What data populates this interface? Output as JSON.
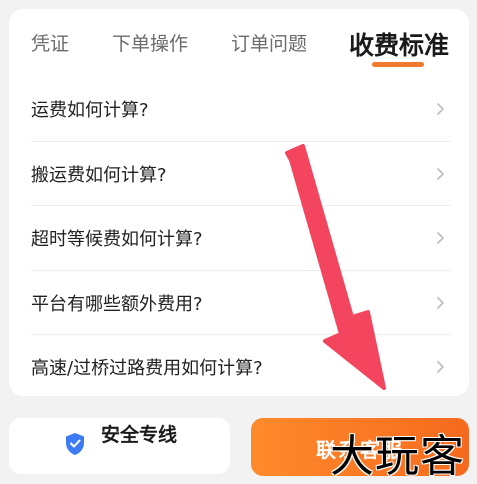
{
  "tabs": [
    {
      "label": "凭证",
      "active": false
    },
    {
      "label": "下单操作",
      "active": false
    },
    {
      "label": "订单问题",
      "active": false
    },
    {
      "label": "收费标准",
      "active": true
    }
  ],
  "faq_items": [
    {
      "label": "运费如何计算?"
    },
    {
      "label": "搬运费如何计算?"
    },
    {
      "label": "超时等候费如何计算?"
    },
    {
      "label": "平台有哪些额外费用?"
    },
    {
      "label": "高速/过桥过路费用如何计算?"
    }
  ],
  "bottom": {
    "safety_label": "安全专线",
    "contact_label": "联系客服"
  },
  "watermark": {
    "text": "大玩客"
  },
  "colors": {
    "accent": "#f07a2d",
    "arrow": "#f4455f",
    "shield": "#3d7bf5",
    "card_bg": "#ffffff",
    "page_bg": "#f2f2f2"
  },
  "icons": {
    "row_chevron": "chevron-right-icon",
    "safety": "shield-icon",
    "annotation": "arrow-down-annotation"
  }
}
